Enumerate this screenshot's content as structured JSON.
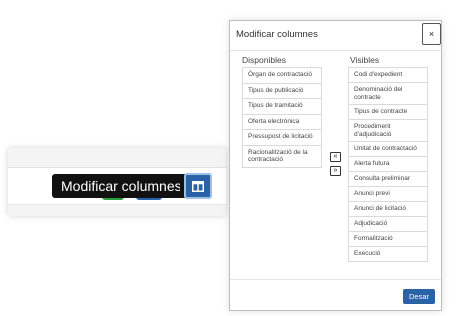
{
  "toolbar": {
    "tooltip": "Modificar columnes",
    "columns_icon": "columns-icon"
  },
  "modal": {
    "title": "Modificar columnes",
    "close_label": "×",
    "available_heading": "Disponibles",
    "visible_heading": "Visibles",
    "available": [
      "Òrgan de contractació",
      "Tipus de publicació",
      "Tipus de tramitació",
      "Oferta electrònica",
      "Pressupost de licitació",
      "Racionalització de la contractació"
    ],
    "visible": [
      "Codi d'expedient",
      "Denominació del contracte",
      "Tipus de contracte",
      "Procediment d'adjudicació",
      "Unitat de contractació",
      "Alerta futura",
      "Consulta preliminar",
      "Anunci previ",
      "Anunci de licitació",
      "Adjudicació",
      "Formalització",
      "Execució"
    ],
    "move_left_label": "«",
    "move_right_label": "»",
    "save_label": "Desar"
  },
  "colors": {
    "primary": "#2a62a8",
    "success": "#2e9e3e",
    "tooltip_bg": "#111111"
  }
}
